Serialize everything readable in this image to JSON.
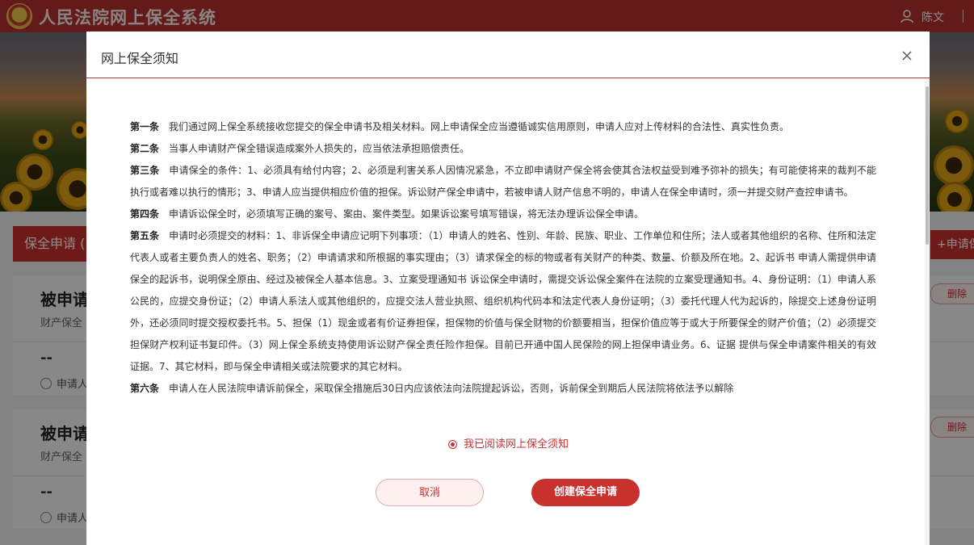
{
  "app": {
    "title": "人民法院网上保全系统",
    "user": "陈文",
    "logo": "court-emblem"
  },
  "page": {
    "section_tab": "保全申请 (",
    "apply_button": "+申请保",
    "cards": [
      {
        "title": "被申请",
        "subtitle": "财产保全",
        "dash": "--",
        "person": "申请人",
        "delete_label": "删除"
      },
      {
        "title": "被申请",
        "subtitle": "财产保全",
        "dash": "--",
        "person": "申请人",
        "delete_label": "删除"
      }
    ]
  },
  "modal": {
    "title": "网上保全须知",
    "clauses": [
      {
        "label": "第一条",
        "text": "我们通过网上保全系统接收您提交的保全申请书及相关材料。网上申请保全应当遵循诚实信用原则，申请人应对上传材料的合法性、真实性负责。"
      },
      {
        "label": "第二条",
        "text": "当事人申请财产保全错误造成案外人损失的，应当依法承担赔偿责任。"
      },
      {
        "label": "第三条",
        "text": "申请保全的条件：1、必须具有给付内容；2、必须是利害关系人因情况紧急，不立即申请财产保全将会使其合法权益受到难予弥补的损失；有可能使将来的裁判不能执行或者难以执行的情形；3、申请人应当提供相应价值的担保。诉讼财产保全申请中，若被申请人财产信息不明的，申请人在保全申请时，须一并提交财产查控申请书。"
      },
      {
        "label": "第四条",
        "text": "申请诉讼保全时，必须填写正确的案号、案由、案件类型。如果诉讼案号填写错误，将无法办理诉讼保全申请。"
      },
      {
        "label": "第五条",
        "text": "申请时必须提交的材料：1、非诉保全申请应记明下列事项：（1）申请人的姓名、性别、年龄、民族、职业、工作单位和住所；法人或者其他组织的名称、住所和法定代表人或者主要负责人的姓名、职务；（2）申请请求和所根据的事实理由；（3）请求保全的标的物或者有关财产的种类、数量、价额及所在地。2、起诉书 申请人需提供申请保全的起诉书，说明保全原由、经过及被保全人基本信息。3、立案受理通知书 诉讼保全申请时，需提交诉讼保全案件在法院的立案受理通知书。4、身份证明：（1）申请人系公民的，应提交身份证；（2）申请人系法人或其他组织的，应提交法人营业执照、组织机构代码本和法定代表人身份证明；（3）委托代理人代为起诉的，除提交上述身份证明外，还必须同时提交授权委托书。5、担保（1）现金或者有价证券担保，担保物的价值与保全财物的价额要相当，担保价值应等于或大于所要保全的财产价值；（2）必须提交担保财产权利证书复印件。（3）网上保全系统支持使用诉讼财产保全责任险作担保。目前已开通中国人民保险的网上担保申请业务。6、证据 提供与保全申请案件相关的有效证据。7、其它材料，即与保全申请相关或法院要求的其它材料。"
      },
      {
        "label": "第六条",
        "text": "申请人在人民法院申请诉前保全，采取保全措施后30日内应该依法向法院提起诉讼，否则，诉前保全到期后人民法院将依法予以解除"
      }
    ],
    "agree_label": "我已阅读网上保全须知",
    "agree_checked": true,
    "cancel_label": "取消",
    "create_label": "创建保全申请"
  },
  "colors": {
    "brand": "#c9312f",
    "header": "#b5312e"
  }
}
